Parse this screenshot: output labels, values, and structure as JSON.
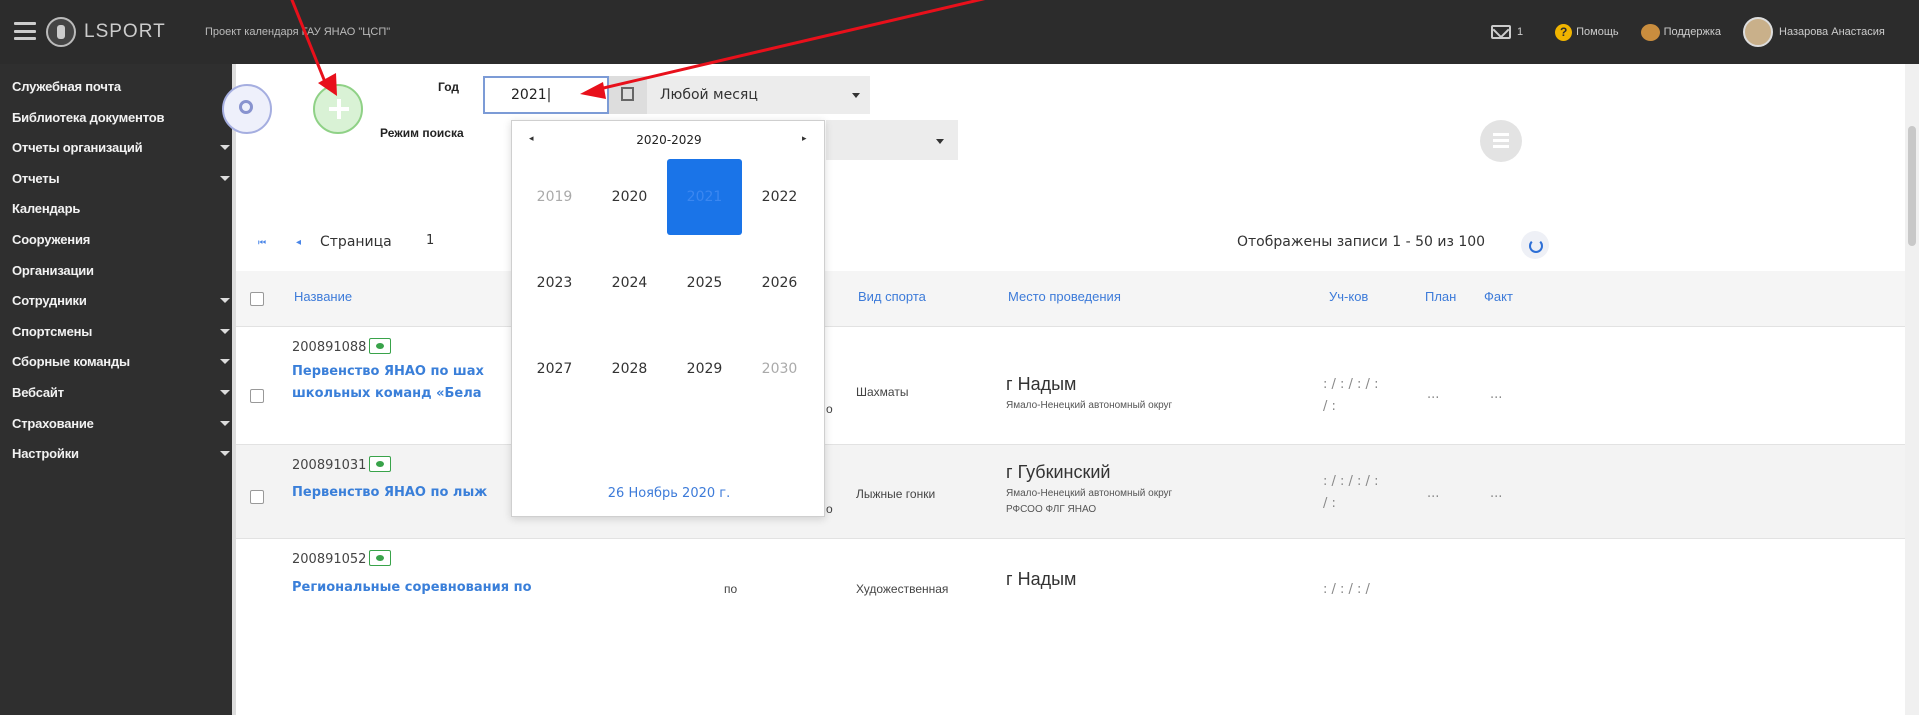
{
  "header": {
    "logo_text": "LSPORT",
    "project_title": "Проект календаря ГАУ ЯНАО \"ЦСП\"",
    "mail_count": "1",
    "help_label": "Помощь",
    "support_label": "Поддержка",
    "user_name": "Назарова Анастасия"
  },
  "sidebar": {
    "items": [
      {
        "label": "Служебная почта",
        "has_submenu": false
      },
      {
        "label": "Библиотека документов",
        "has_submenu": false
      },
      {
        "label": "Отчеты организаций",
        "has_submenu": true
      },
      {
        "label": "Отчеты",
        "has_submenu": true
      },
      {
        "label": "Календарь",
        "has_submenu": false
      },
      {
        "label": "Сооружения",
        "has_submenu": false
      },
      {
        "label": "Организации",
        "has_submenu": false
      },
      {
        "label": "Сотрудники",
        "has_submenu": true
      },
      {
        "label": "Спортсмены",
        "has_submenu": true
      },
      {
        "label": "Сборные команды",
        "has_submenu": true
      },
      {
        "label": "Вебсайт",
        "has_submenu": true
      },
      {
        "label": "Страхование",
        "has_submenu": true
      },
      {
        "label": "Настройки",
        "has_submenu": true
      }
    ]
  },
  "filters": {
    "year_label": "Год",
    "year_value": "2021|",
    "month_value": "Любой месяц",
    "mode_label": "Режим поиска"
  },
  "year_picker": {
    "range": "2020-2029",
    "prev": "◂",
    "next": "▸",
    "years": [
      {
        "year": "2019",
        "state": "muted"
      },
      {
        "year": "2020",
        "state": "normal"
      },
      {
        "year": "2021",
        "state": "selected"
      },
      {
        "year": "2022",
        "state": "normal"
      },
      {
        "year": "2023",
        "state": "normal"
      },
      {
        "year": "2024",
        "state": "normal"
      },
      {
        "year": "2025",
        "state": "normal"
      },
      {
        "year": "2026",
        "state": "normal"
      },
      {
        "year": "2027",
        "state": "normal"
      },
      {
        "year": "2028",
        "state": "normal"
      },
      {
        "year": "2029",
        "state": "normal"
      },
      {
        "year": "2030",
        "state": "muted"
      }
    ],
    "today": "26 Ноябрь 2020 г."
  },
  "pager": {
    "first": "⏮",
    "prev": "◂",
    "page_label": "Страница",
    "page_value": "1",
    "records_text": "Отображены записи 1 - 50 из 100"
  },
  "grid": {
    "headers": {
      "name": "Название",
      "sport": "Вид спорта",
      "venue": "Место проведения",
      "participants": "Уч-ков",
      "plan": "План",
      "fact": "Факт"
    },
    "rows": [
      {
        "id": "200891088",
        "name_line1": "Первенство ЯНАО по шах",
        "name_line2": "школьных команд «Бела",
        "col_trunc": "о",
        "sport": "Шахматы",
        "city": "г Надым",
        "region1": "Ямало-Ненецкий автономный округ",
        "region2": "",
        "part_line1": ": / : / : / :",
        "part_line2": "/ :",
        "plan": "...",
        "fact": "..."
      },
      {
        "id": "200891031",
        "name_line1": "Первенство ЯНАО по лыж",
        "name_line2": "",
        "col_trunc": "о",
        "sport": "Лыжные гонки",
        "city": "г Губкинский",
        "region1": "Ямало-Ненецкий автономный округ",
        "region2": "РФСОО ФЛГ ЯНАО",
        "part_line1": ": / : / : / :",
        "part_line2": "/ :",
        "plan": "...",
        "fact": "..."
      },
      {
        "id": "200891052",
        "name_line1": "Региональные соревнования по",
        "name_line2": "",
        "col_trunc": "по",
        "sport": "Художественная",
        "city": "г Надым",
        "region1": "",
        "region2": "",
        "part_line1": ": / : / : /",
        "part_line2": "",
        "plan": "",
        "fact": ""
      }
    ]
  },
  "colors": {
    "topbar": "#2c2c2c",
    "sidebar": "#2f2f2f",
    "accent_blue": "#1a74e8",
    "link_blue": "#3a7fd9",
    "add_green": "#8fd186",
    "annotation_red": "#e8101b"
  }
}
